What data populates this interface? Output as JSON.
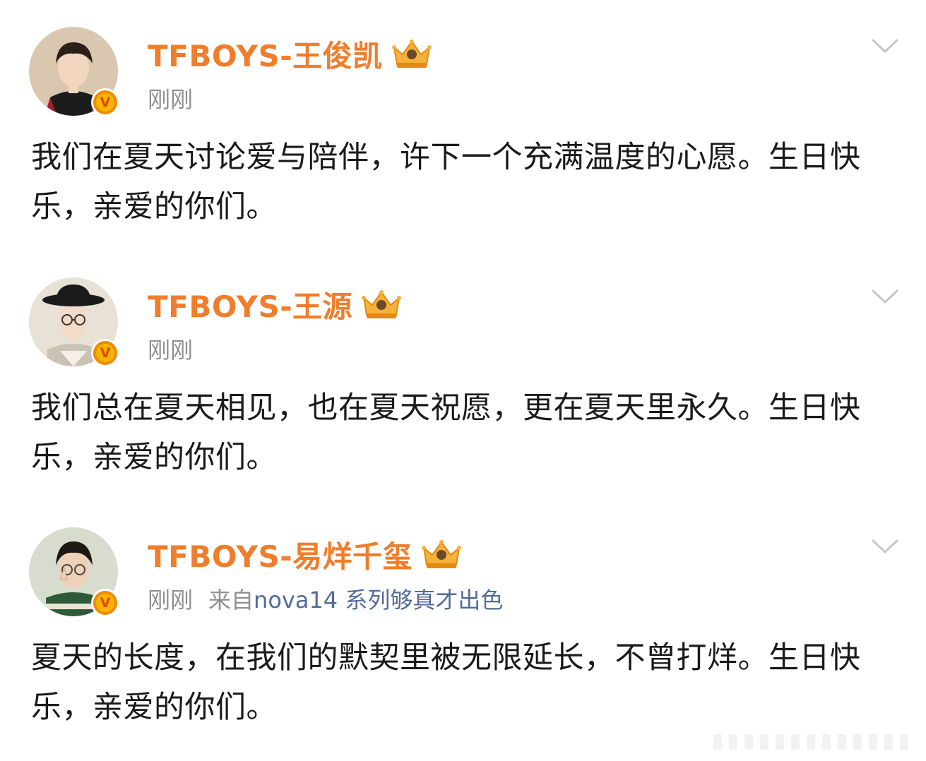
{
  "posts": [
    {
      "username": "TFBOYS-王俊凯",
      "time": "刚刚",
      "source_prefix": "",
      "source_device": "",
      "text": "我们在夏天讨论爱与陪伴，许下一个充满温度的心愿。生日快乐，亲爱的你们。",
      "verified_mark": "V"
    },
    {
      "username": "TFBOYS-王源",
      "time": "刚刚",
      "source_prefix": "",
      "source_device": "",
      "text": "我们总在夏天相见，也在夏天祝愿，更在夏天里永久。生日快乐，亲爱的你们。",
      "verified_mark": "V"
    },
    {
      "username": "TFBOYS-易烊千玺",
      "time": "刚刚",
      "source_prefix": "来自",
      "source_device": "nova14 系列够真才出色",
      "text": "夏天的长度，在我们的默契里被无限延长，不曾打烊。生日快乐，亲爱的你们。",
      "verified_mark": "V"
    }
  ],
  "colors": {
    "username": "#f07d2a",
    "meta": "#8f8f8f",
    "source_link": "#526b9a",
    "body_text": "#1a1a1a",
    "verified_badge": "#f08a00"
  },
  "icons": {
    "badge": "crown-icon",
    "verified": "verified-v-icon",
    "menu": "chevron-down-icon"
  }
}
